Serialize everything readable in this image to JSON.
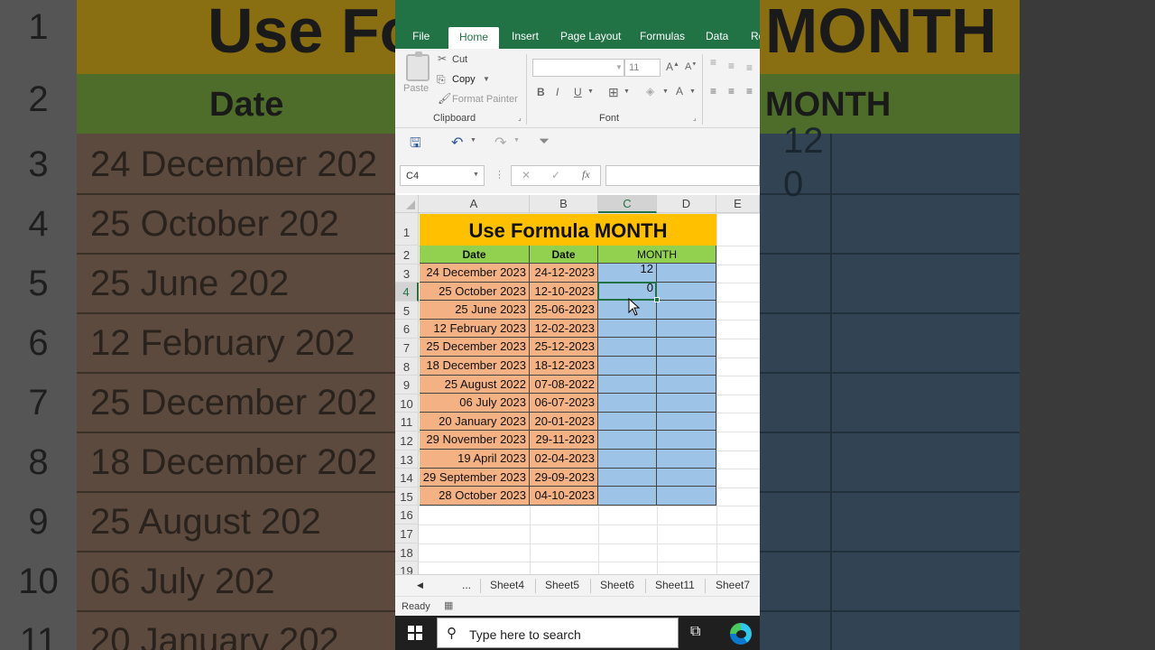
{
  "background": {
    "title_partial": "Use Fo",
    "title_tail": "MONTH",
    "header_date": "Date",
    "header_month": "MONTH",
    "row_numbers": [
      "1",
      "2",
      "3",
      "4",
      "5",
      "6",
      "7",
      "8",
      "9",
      "10",
      "11"
    ],
    "dates_partial": [
      "24 December 202",
      "25 October 202",
      "25 June 202",
      "12 February 202",
      "25 December 202",
      "18 December 202",
      "25 August 202",
      "06 July 202",
      "20 January 202"
    ],
    "right_values": [
      "12",
      "0"
    ]
  },
  "ribbon": {
    "tabs": [
      "File",
      "Home",
      "Insert",
      "Page Layout",
      "Formulas",
      "Data",
      "Re"
    ],
    "active_tab": "Home",
    "clipboard": {
      "paste": "Paste",
      "cut": "Cut",
      "copy": "Copy",
      "format_painter": "Format Painter",
      "group_label": "Clipboard"
    },
    "font": {
      "size": "11",
      "group_label": "Font",
      "bold": "B",
      "italic": "I",
      "underline": "U"
    }
  },
  "formula_bar": {
    "name_box": "C4",
    "fx": "fx",
    "formula": ""
  },
  "sheet": {
    "columns": [
      "A",
      "B",
      "C",
      "D",
      "E"
    ],
    "selected_column": "C",
    "selected_row": "4",
    "row_numbers": [
      "1",
      "2",
      "3",
      "4",
      "5",
      "6",
      "7",
      "8",
      "9",
      "10",
      "11",
      "12",
      "13",
      "14",
      "15",
      "16",
      "17",
      "18",
      "19"
    ],
    "title": "Use Formula MONTH",
    "headers": [
      "Date",
      "Date",
      "MONTH"
    ],
    "rows": [
      {
        "a": "24 December 2023",
        "b": "24-12-2023",
        "c": "12"
      },
      {
        "a": "25 October 2023",
        "b": "12-10-2023",
        "c": "0"
      },
      {
        "a": "25 June 2023",
        "b": "25-06-2023",
        "c": ""
      },
      {
        "a": "12 February 2023",
        "b": "12-02-2023",
        "c": ""
      },
      {
        "a": "25 December 2023",
        "b": "25-12-2023",
        "c": ""
      },
      {
        "a": "18 December 2023",
        "b": "18-12-2023",
        "c": ""
      },
      {
        "a": "25 August 2022",
        "b": "07-08-2022",
        "c": ""
      },
      {
        "a": "06 July 2023",
        "b": "06-07-2023",
        "c": ""
      },
      {
        "a": "20 January 2023",
        "b": "20-01-2023",
        "c": ""
      },
      {
        "a": "29 November 2023",
        "b": "29-11-2023",
        "c": ""
      },
      {
        "a": "19 April 2023",
        "b": "02-04-2023",
        "c": ""
      },
      {
        "a": "29 September 2023",
        "b": "29-09-2023",
        "c": ""
      },
      {
        "a": "28 October 2023",
        "b": "04-10-2023",
        "c": ""
      }
    ],
    "colors": {
      "title_bg": "#ffc000",
      "header_bg": "#92d050",
      "date_bg": "#f4b183",
      "month_bg": "#9dc3e6",
      "accent": "#217346"
    }
  },
  "sheet_tabs": {
    "more": "...",
    "tabs": [
      "Sheet4",
      "Sheet5",
      "Sheet6",
      "Sheet11",
      "Sheet7"
    ]
  },
  "status": {
    "ready": "Ready"
  },
  "taskbar": {
    "search_placeholder": "Type here to search"
  }
}
